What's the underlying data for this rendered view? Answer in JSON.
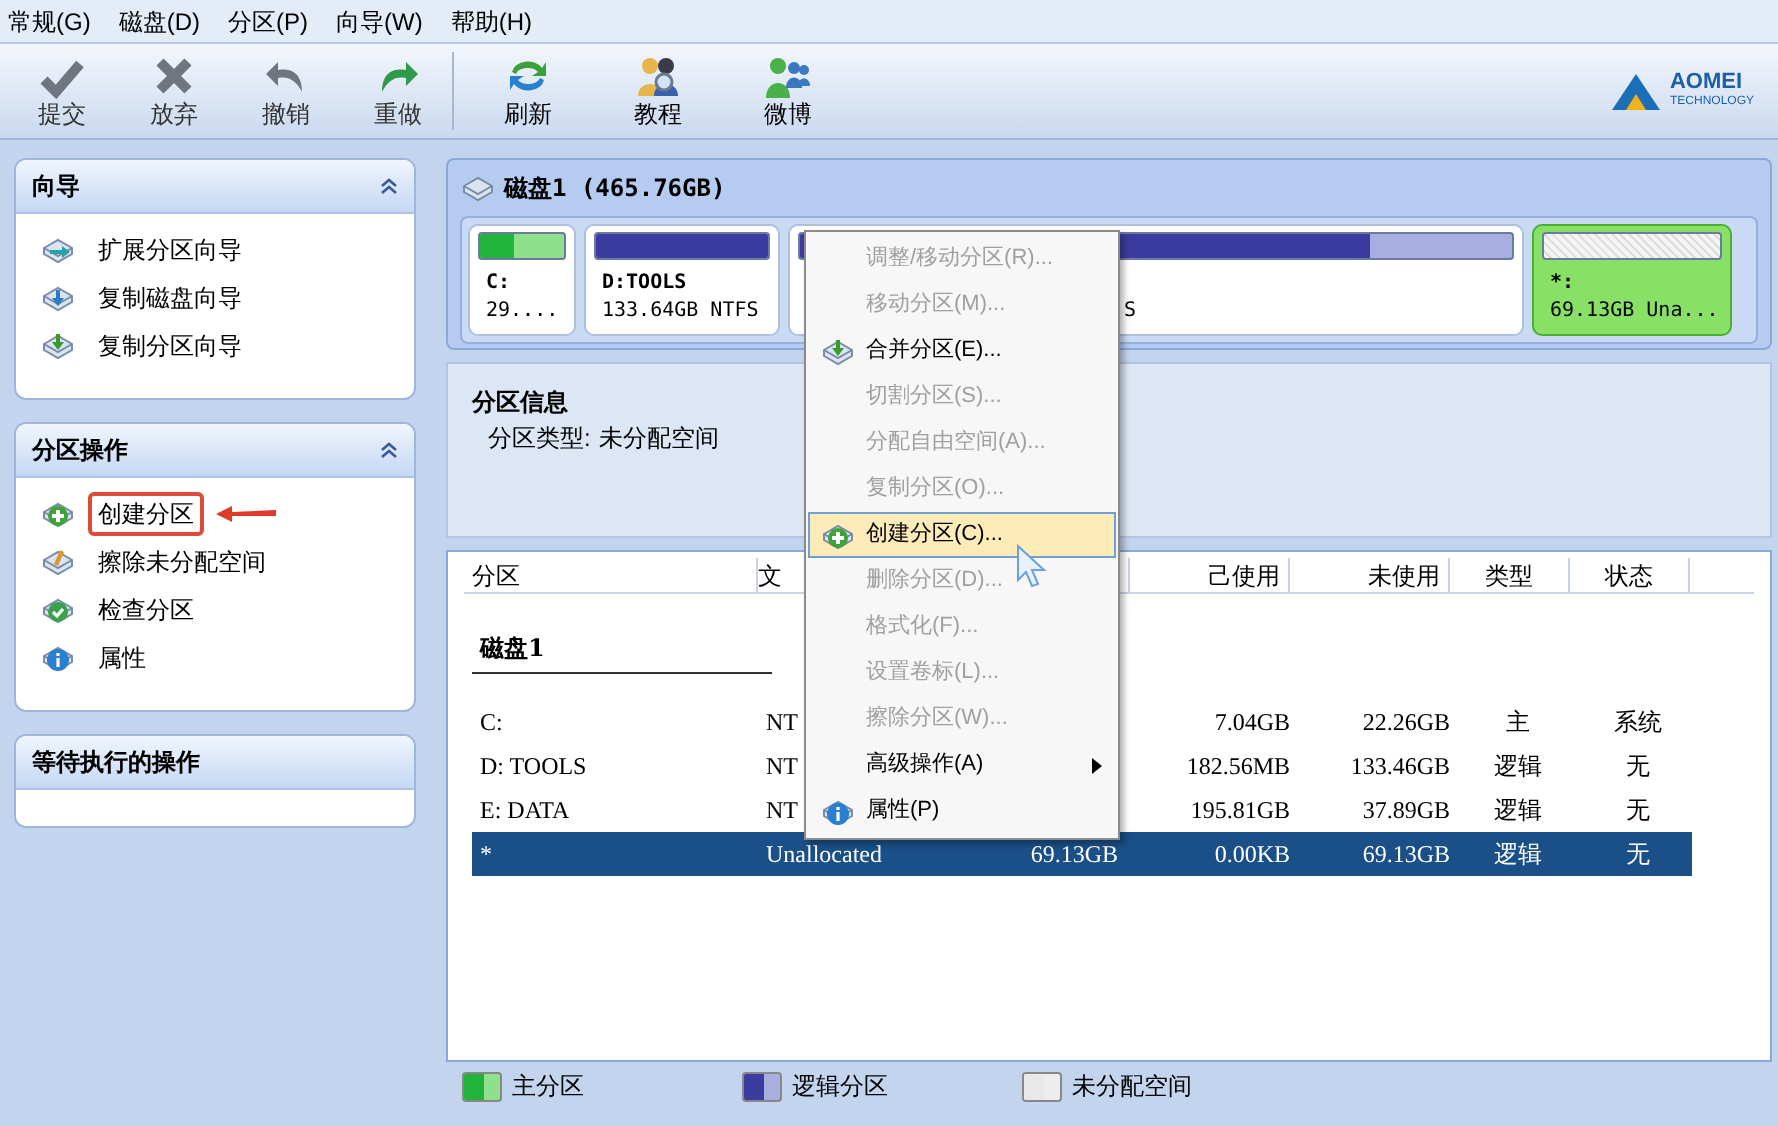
{
  "menu_bar": [
    "常规(G)",
    "磁盘(D)",
    "分区(P)",
    "向导(W)",
    "帮助(H)"
  ],
  "toolbar": {
    "groups": [
      [
        {
          "label": "提交",
          "disabled": true
        },
        {
          "label": "放弃",
          "disabled": true
        },
        {
          "label": "撤销",
          "disabled": true
        },
        {
          "label": "重做",
          "disabled": true
        }
      ],
      [
        {
          "label": "刷新",
          "disabled": false
        },
        {
          "label": "教程",
          "disabled": false
        },
        {
          "label": "微博",
          "disabled": false
        }
      ]
    ],
    "logo": {
      "name": "AOMEI",
      "tagline": "TECHNOLOGY"
    }
  },
  "sidebar": [
    {
      "title": "向导",
      "collapsible": true,
      "items": [
        {
          "label": "扩展分区向导",
          "highlighted": false
        },
        {
          "label": "复制磁盘向导",
          "highlighted": false
        },
        {
          "label": "复制分区向导",
          "highlighted": false
        }
      ]
    },
    {
      "title": "分区操作",
      "collapsible": true,
      "items": [
        {
          "label": "创建分区",
          "highlighted": true
        },
        {
          "label": "擦除未分配空间",
          "highlighted": false
        },
        {
          "label": "检查分区",
          "highlighted": false
        },
        {
          "label": "属性",
          "highlighted": false
        }
      ]
    },
    {
      "title": "等待执行的操作",
      "collapsible": false
    }
  ],
  "disk_map": {
    "title": "磁盘1 (465.76GB)",
    "partitions": [
      {
        "kind": "primary",
        "name": "C:",
        "info": "29....",
        "level": 0.4,
        "selected": false
      },
      {
        "kind": "logical",
        "name": "D:TOOLS",
        "info": "133.64GB NTFS",
        "level": 1,
        "selected": false
      },
      {
        "kind": "logical",
        "info": "S",
        "level": 0.8,
        "selected": false
      },
      {
        "kind": "unallocated",
        "name": "*:",
        "info": "69.13GB Una...",
        "selected": true
      }
    ]
  },
  "partition_info": {
    "title": "分区信息",
    "type_label": "分区类型:",
    "type_value": "未分配空间"
  },
  "table": {
    "columns": {
      "partition": "分区",
      "file_system": "文",
      "used": "己使用",
      "free": "未使用",
      "type": "类型",
      "status": "状态"
    },
    "disk_label": "磁盘1",
    "rows": [
      {
        "partition": "C:",
        "file_system": "NT",
        "used": "7.04GB",
        "free": "22.26GB",
        "type": "主",
        "status": "系统",
        "selected": false
      },
      {
        "partition": "D: TOOLS",
        "file_system": "NT",
        "used": "182.56MB",
        "free": "133.46GB",
        "type": "逻辑",
        "status": "无",
        "selected": false
      },
      {
        "partition": "E: DATA",
        "file_system": "NT",
        "used": "195.81GB",
        "free": "37.89GB",
        "type": "逻辑",
        "status": "无",
        "selected": false
      },
      {
        "partition": "*",
        "file_system": "Unallocated",
        "capacity": "69.13GB",
        "used": "0.00KB",
        "free": "69.13GB",
        "type": "逻辑",
        "status": "无",
        "selected": true
      }
    ]
  },
  "legend": [
    {
      "kind": "primary",
      "label": "主分区"
    },
    {
      "kind": "logical",
      "label": "逻辑分区"
    },
    {
      "kind": "unallocated",
      "label": "未分配空间"
    }
  ],
  "context_menu": [
    {
      "kind": "item",
      "label": "调整/移动分区(R)...",
      "disabled": true,
      "selected": false
    },
    {
      "kind": "item",
      "label": "移动分区(M)...",
      "disabled": true,
      "selected": false
    },
    {
      "kind": "item",
      "label": "合并分区(E)...",
      "disabled": false,
      "selected": false
    },
    {
      "kind": "item",
      "label": "切割分区(S)...",
      "disabled": true,
      "selected": false
    },
    {
      "kind": "item",
      "label": "分配自由空间(A)...",
      "disabled": true,
      "selected": false
    },
    {
      "kind": "item",
      "label": "复制分区(O)...",
      "disabled": true,
      "selected": false
    },
    {
      "kind": "item",
      "label": "创建分区(C)...",
      "disabled": false,
      "selected": true
    },
    {
      "kind": "item",
      "label": "删除分区(D)...",
      "disabled": true,
      "selected": false
    },
    {
      "kind": "item",
      "label": "格式化(F)...",
      "disabled": true,
      "selected": false
    },
    {
      "kind": "item",
      "label": "设置卷标(L)...",
      "disabled": true,
      "selected": false
    },
    {
      "kind": "item",
      "label": "擦除分区(W)...",
      "disabled": true,
      "selected": false
    },
    {
      "kind": "submenu",
      "label": "高级操作(A)",
      "disabled": false,
      "selected": false
    },
    {
      "kind": "item",
      "label": "属性(P)",
      "disabled": false,
      "selected": false
    }
  ]
}
